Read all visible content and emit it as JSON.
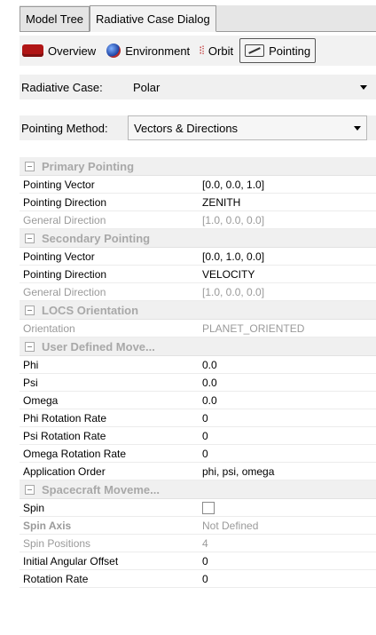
{
  "tabs": [
    {
      "label": "Model Tree",
      "active": false
    },
    {
      "label": "Radiative Case Dialog",
      "active": true
    }
  ],
  "subtabs": [
    {
      "label": "Overview",
      "icon": "overview-icon",
      "active": false
    },
    {
      "label": "Environment",
      "icon": "globe-icon",
      "active": false
    },
    {
      "label": "Orbit",
      "icon": "orbit-icon",
      "active": false
    },
    {
      "label": "Pointing",
      "icon": "pointing-icon",
      "active": true
    }
  ],
  "radiative_case": {
    "label": "Radiative Case:",
    "value": "Polar"
  },
  "pointing_method": {
    "label": "Pointing Method:",
    "value": "Vectors & Directions"
  },
  "sections": {
    "primary": {
      "title": "Primary Pointing",
      "rows": [
        {
          "key": "Pointing Vector",
          "value": "[0.0, 0.0, 1.0]",
          "disabled": false
        },
        {
          "key": "Pointing Direction",
          "value": "ZENITH",
          "disabled": false
        },
        {
          "key": "General Direction",
          "value": "[1.0, 0.0, 0.0]",
          "disabled": true
        }
      ]
    },
    "secondary": {
      "title": "Secondary Pointing",
      "rows": [
        {
          "key": "Pointing Vector",
          "value": "[0.0, 1.0, 0.0]",
          "disabled": false
        },
        {
          "key": "Pointing Direction",
          "value": "VELOCITY",
          "disabled": false
        },
        {
          "key": "General Direction",
          "value": "[1.0, 0.0, 0.0]",
          "disabled": true
        }
      ]
    },
    "locs": {
      "title": "LOCS Orientation",
      "rows": [
        {
          "key": "Orientation",
          "value": "PLANET_ORIENTED",
          "disabled": true
        }
      ]
    },
    "user": {
      "title": "User Defined Move...",
      "rows": [
        {
          "key": "Phi",
          "value": "0.0"
        },
        {
          "key": "Psi",
          "value": "0.0"
        },
        {
          "key": "Omega",
          "value": "0.0"
        },
        {
          "key": "Phi Rotation Rate",
          "value": "0"
        },
        {
          "key": "Psi Rotation Rate",
          "value": "0"
        },
        {
          "key": "Omega Rotation Rate",
          "value": "0"
        },
        {
          "key": "Application Order",
          "value": "phi, psi, omega"
        }
      ]
    },
    "spacecraft": {
      "title": "Spacecraft Moveme...",
      "spin_label": "Spin",
      "spin_checked": false,
      "spin_axis": {
        "key": "Spin Axis",
        "value": "Not Defined"
      },
      "spin_positions": {
        "key": "Spin Positions",
        "value": "4"
      },
      "initial_offset": {
        "key": "Initial Angular Offset",
        "value": "0"
      },
      "rotation_rate": {
        "key": "Rotation Rate",
        "value": "0"
      }
    }
  }
}
